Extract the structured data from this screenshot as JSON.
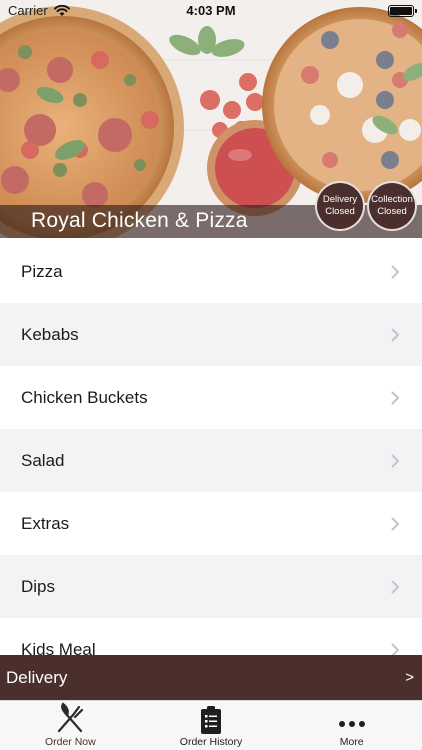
{
  "status_bar": {
    "carrier": "Carrier",
    "time": "4:03 PM"
  },
  "header": {
    "restaurant_name": "Royal Chicken & Pizza"
  },
  "delivery_status": {
    "line1": "Delivery",
    "line2": "Closed"
  },
  "collection_status": {
    "line1": "Collection",
    "line2": "Closed"
  },
  "menu": {
    "categories": [
      {
        "label": "Pizza"
      },
      {
        "label": "Kebabs"
      },
      {
        "label": "Chicken Buckets"
      },
      {
        "label": "Salad"
      },
      {
        "label": "Extras"
      },
      {
        "label": "Dips"
      },
      {
        "label": "Kids Meal"
      }
    ]
  },
  "order_type_bar": {
    "label": "Delivery",
    "arrow": ">"
  },
  "tabs": [
    {
      "label": "Order Now",
      "icon": "fork-knife-icon"
    },
    {
      "label": "Order History",
      "icon": "clipboard-list-icon"
    },
    {
      "label": "More",
      "icon": "more-dots-icon"
    }
  ],
  "colors": {
    "brand_brown": "#4a2f2c",
    "row_alt": "#f2f3f5",
    "tab_bar": "#f7f7f7"
  }
}
